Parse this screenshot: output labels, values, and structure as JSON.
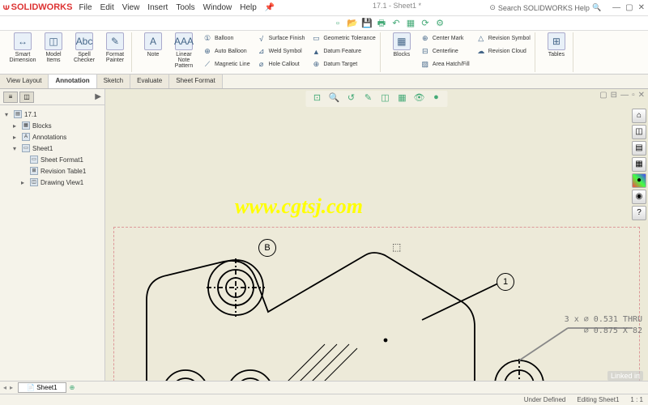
{
  "app": {
    "name": "SOLIDWORKS",
    "doc_title": "17.1 - Sheet1 *"
  },
  "menu": [
    "File",
    "Edit",
    "View",
    "Insert",
    "Tools",
    "Window",
    "Help"
  ],
  "search": {
    "placeholder": "Search SOLIDWORKS Help"
  },
  "ribbon": {
    "big": [
      {
        "label": "Smart Dimension",
        "icon": "↔"
      },
      {
        "label": "Model Items",
        "icon": "◫"
      },
      {
        "label": "Spell Checker",
        "icon": "Abc"
      },
      {
        "label": "Format Painter",
        "icon": "✎"
      },
      {
        "label": "Note",
        "icon": "A"
      },
      {
        "label": "Linear Note Pattern",
        "icon": "AAA"
      }
    ],
    "col1": [
      {
        "label": "Balloon",
        "icon": "①"
      },
      {
        "label": "Auto Balloon",
        "icon": "⊕"
      },
      {
        "label": "Magnetic Line",
        "icon": "⟋"
      }
    ],
    "col2": [
      {
        "label": "Surface Finish",
        "icon": "√"
      },
      {
        "label": "Weld Symbol",
        "icon": "⊿"
      },
      {
        "label": "Hole Callout",
        "icon": "⌀"
      }
    ],
    "col3": [
      {
        "label": "Geometric Tolerance",
        "icon": "▭"
      },
      {
        "label": "Datum Feature",
        "icon": "▲"
      },
      {
        "label": "Datum Target",
        "icon": "⊕"
      }
    ],
    "blocks": {
      "label": "Blocks",
      "icon": "▦"
    },
    "col4": [
      {
        "label": "Center Mark",
        "icon": "⊕"
      },
      {
        "label": "Centerline",
        "icon": "⊟"
      },
      {
        "label": "Area Hatch/Fill",
        "icon": "▨"
      }
    ],
    "col5": [
      {
        "label": "Revision Symbol",
        "icon": "△"
      },
      {
        "label": "Revision Cloud",
        "icon": "☁"
      }
    ],
    "tables": {
      "label": "Tables",
      "icon": "⊞"
    }
  },
  "tabs": [
    "View Layout",
    "Annotation",
    "Sketch",
    "Evaluate",
    "Sheet Format"
  ],
  "active_tab": "Annotation",
  "tree": {
    "root": "17.1",
    "items": [
      {
        "label": "Blocks",
        "icon": "▦"
      },
      {
        "label": "Annotations",
        "icon": "A"
      },
      {
        "label": "Sheet1",
        "icon": "▭",
        "expanded": true,
        "children": [
          {
            "label": "Sheet Format1",
            "icon": "▭"
          },
          {
            "label": "Revision Table1",
            "icon": "⊞"
          },
          {
            "label": "Drawing View1",
            "icon": "◫"
          }
        ]
      }
    ]
  },
  "balloons": {
    "B": "B",
    "one": "1"
  },
  "dims": {
    "line1": "3 x ⌀ 0.531 THRU",
    "line2": "⌀ 0.875 X 82"
  },
  "watermark": "www.cgtsj.com",
  "bottom_tab": "Sheet1",
  "status": {
    "defined": "Under Defined",
    "editing": "Editing Sheet1",
    "scale": "1 : 1"
  },
  "badge": "Linked in"
}
